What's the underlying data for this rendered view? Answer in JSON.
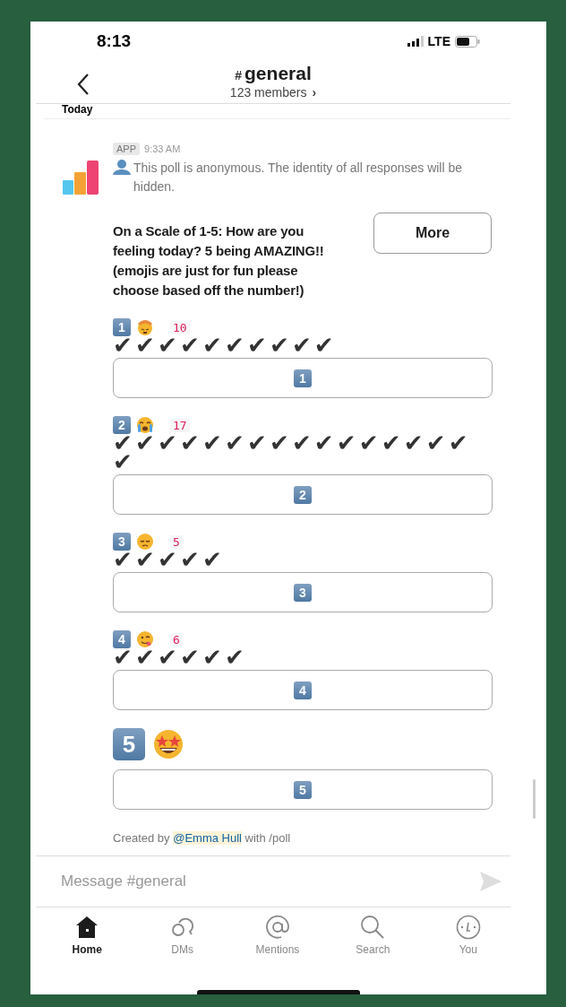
{
  "status_bar": {
    "time": "8:13",
    "network": "LTE"
  },
  "header": {
    "hash": "#",
    "channel": "general",
    "members": "123 members",
    "members_arrow": "›"
  },
  "day_label": "Today",
  "message": {
    "badge": "APP",
    "time": "9:33 AM",
    "notice": "This poll is anonymous. The identity of all responses will be hidden.",
    "question": "On a Scale of 1-5: How are you feeling today? 5 being AMAZING!! (emojis are just for fun please choose based off the number!)",
    "more_button": "More",
    "options": [
      {
        "number": "1",
        "count": "10",
        "checks": "✔✔✔✔✔✔✔✔✔✔",
        "button": "1"
      },
      {
        "number": "2",
        "count": "17",
        "checks": "✔✔✔✔✔✔✔✔✔✔✔✔✔✔✔✔✔",
        "button": "2"
      },
      {
        "number": "3",
        "count": "5",
        "checks": "✔✔✔✔✔",
        "button": "3"
      },
      {
        "number": "4",
        "count": "6",
        "checks": "✔✔✔✔✔✔",
        "button": "4"
      },
      {
        "number": "5",
        "button": "5"
      }
    ],
    "footer": {
      "before": "Created by",
      "mention": "@Emma Hull",
      "after": "with /poll"
    }
  },
  "composer": {
    "placeholder": "Message #general"
  },
  "tabs": [
    {
      "label": "Home",
      "selected": true
    },
    {
      "label": "DMs",
      "selected": false
    },
    {
      "label": "Mentions",
      "selected": false
    },
    {
      "label": "Search",
      "selected": false
    },
    {
      "label": "You",
      "selected": false
    }
  ]
}
